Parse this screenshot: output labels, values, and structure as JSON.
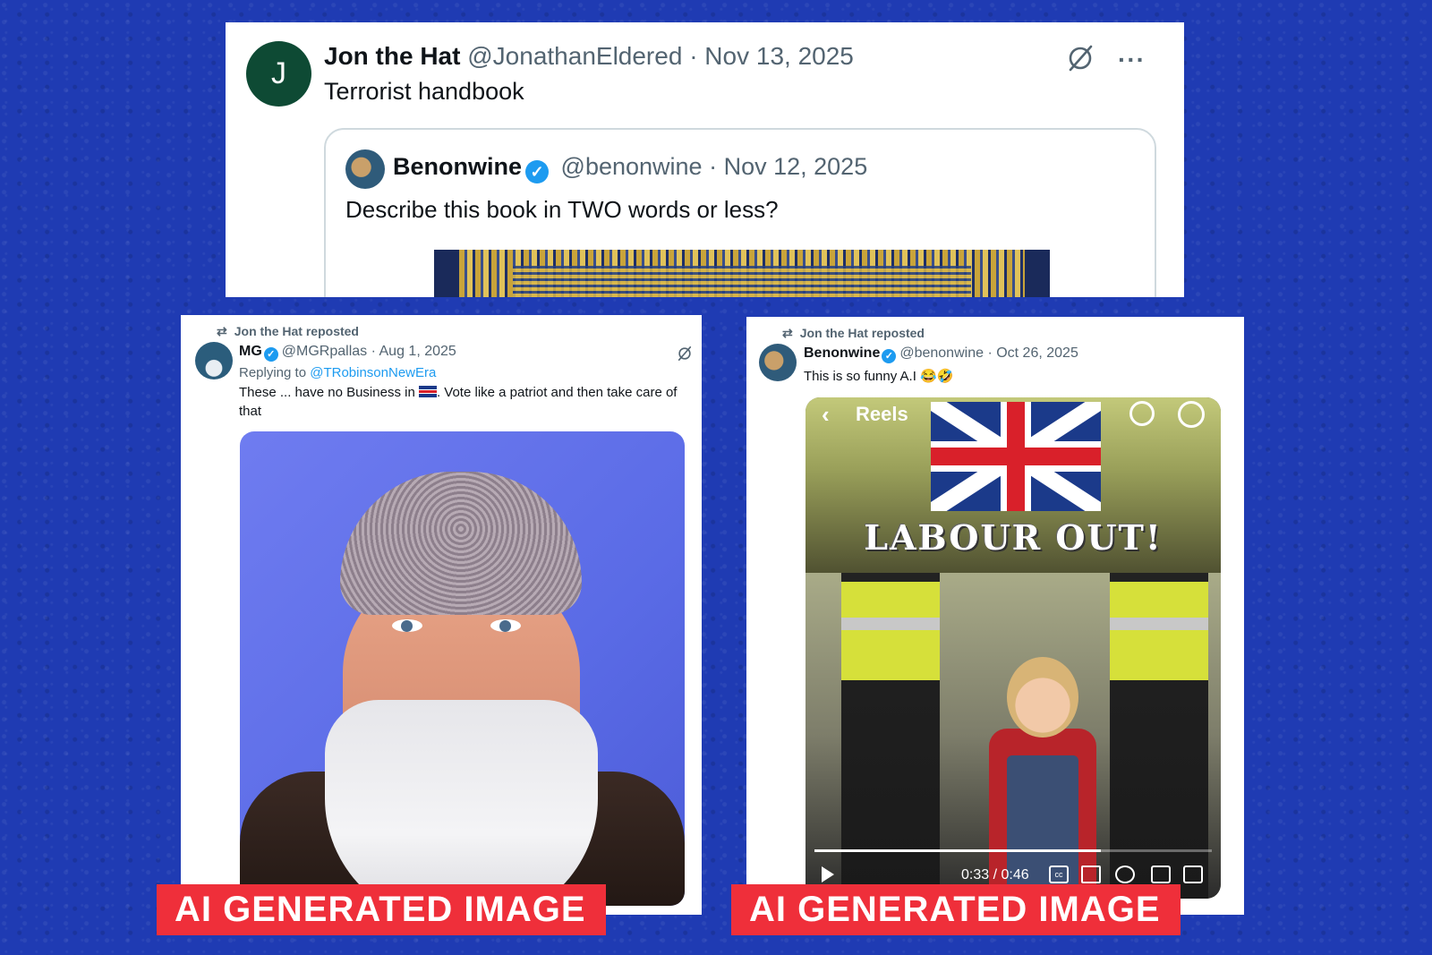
{
  "top_post": {
    "avatar_letter": "J",
    "name": "Jon the Hat",
    "handle": "@JonathanEldered",
    "sep": "·",
    "date": "Nov 13, 2025",
    "text": "Terrorist handbook",
    "more": "···",
    "quote": {
      "name": "Benonwine",
      "handle": "@benonwine",
      "sep": "·",
      "date": "Nov 12, 2025",
      "text": "Describe this book in TWO words or less?"
    }
  },
  "left_post": {
    "repost_label": "Jon the Hat reposted",
    "name": "MG",
    "handle": "@MGRpallas",
    "sep": "·",
    "date": "Aug 1, 2025",
    "reply_prefix": "Replying to ",
    "reply_handle": "@TRobinsonNewEra",
    "text_part1": "These ... have no Business in ",
    "text_part2": ". Vote like a patriot and then take care of that",
    "ai_label": "AI GENERATED IMAGE"
  },
  "right_post": {
    "repost_label": "Jon the Hat reposted",
    "name": "Benonwine",
    "handle": "@benonwine",
    "sep": "·",
    "date": "Oct 26, 2025",
    "text": "This is so funny A.I 😂🤣",
    "video": {
      "app_title": "Reels",
      "caption": "LABOUR OUT!",
      "time": "0:33 / 0:46",
      "progress": 0.72
    },
    "ai_label": "AI GENERATED IMAGE"
  },
  "colors": {
    "background": "#1f3bb3",
    "label_red": "#ef2f3a",
    "verified_blue": "#1d9bf0"
  },
  "icons": [
    "grok-icon",
    "more-icon",
    "verified-badge-icon",
    "repost-icon",
    "back-icon",
    "search-icon",
    "profile-icon",
    "play-icon",
    "cc-icon",
    "volume-icon",
    "settings-icon",
    "fullscreen-icon"
  ]
}
